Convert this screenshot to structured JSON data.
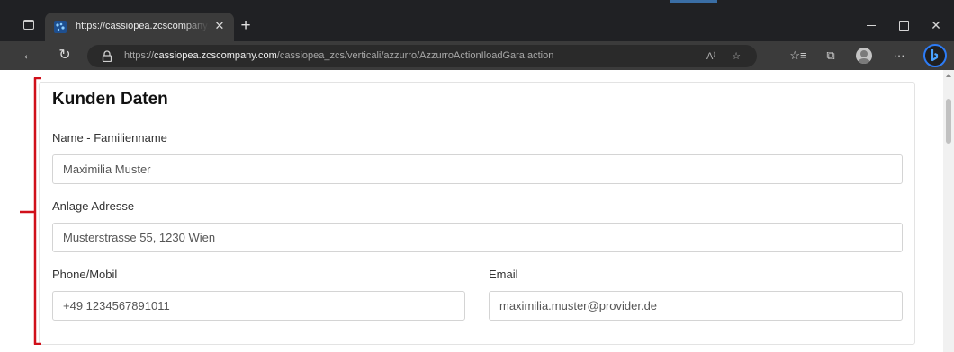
{
  "browser": {
    "tab": {
      "title": "https://cassiopea.zcscompany.com",
      "favicon": "zcs-favicon",
      "close": "✕"
    },
    "new_tab": "+",
    "window_controls": {
      "close": "✕"
    },
    "address_bar": {
      "url_scheme": "https://",
      "url_host": "cassiopea.zcscompany.com",
      "url_path": "/cassiopea_zcs/verticali/azzurro/AzzurroActionIloadGara.action"
    },
    "nav": {
      "back": "←",
      "refresh": "↻"
    },
    "toolbar": {
      "read_aloud": "A⁾",
      "favorites_add": "☆",
      "favorites": "☆≡",
      "collections": "⧉",
      "more": "···"
    }
  },
  "form": {
    "title": "Kunden Daten",
    "name_label": "Name - Familienname",
    "name_value": "Maximilia Muster",
    "address_label": "Anlage Adresse",
    "address_value": "Musterstrasse 55, 1230 Wien",
    "phone_label": "Phone/Mobil",
    "phone_value": "+49 1234567891011",
    "email_label": "Email",
    "email_value": "maximilia.muster@provider.de"
  },
  "colors": {
    "annotation_bracket": "#d0101a",
    "bing_accent": "#2d7cf6",
    "chrome_dark": "#202124"
  }
}
